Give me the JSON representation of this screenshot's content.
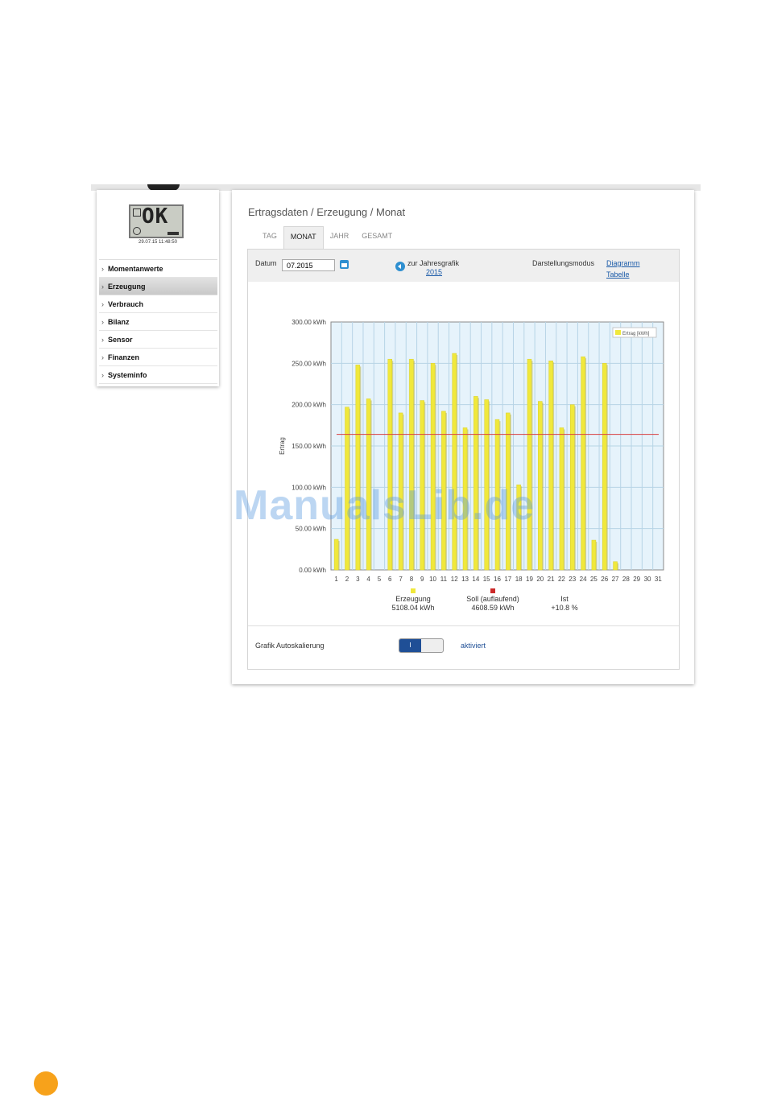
{
  "device": {
    "lcd_text": "OK",
    "timestamp": "29.07.15 11:48:50"
  },
  "menu": [
    {
      "label": "Momentanwerte",
      "active": false
    },
    {
      "label": "Erzeugung",
      "active": true
    },
    {
      "label": "Verbrauch",
      "active": false
    },
    {
      "label": "Bilanz",
      "active": false
    },
    {
      "label": "Sensor",
      "active": false
    },
    {
      "label": "Finanzen",
      "active": false
    },
    {
      "label": "Systeminfo",
      "active": false
    }
  ],
  "breadcrumb": "Ertragsdaten / Erzeugung / Monat",
  "tabs": [
    {
      "label": "TAG",
      "active": false
    },
    {
      "label": "MONAT",
      "active": true
    },
    {
      "label": "JAHR",
      "active": false
    },
    {
      "label": "GESAMT",
      "active": false
    }
  ],
  "controls": {
    "datum_label": "Datum",
    "datum_value": "07.2015",
    "jahresgrafik_label": "zur Jahresgrafik",
    "jahresgrafik_link": "2015",
    "mode_label": "Darstellungsmodus",
    "mode_diagramm": "Diagramm",
    "mode_tabelle": "Tabelle"
  },
  "chart_data": {
    "type": "bar",
    "ylabel": "Ertrag",
    "ylim": [
      0,
      300
    ],
    "yticks": [
      "0.00 kWh",
      "50.00 kWh",
      "100.00 kWh",
      "150.00 kWh",
      "200.00 kWh",
      "250.00 kWh",
      "300.00 kWh"
    ],
    "categories": [
      "1",
      "2",
      "3",
      "4",
      "5",
      "6",
      "7",
      "8",
      "9",
      "10",
      "11",
      "12",
      "13",
      "14",
      "15",
      "16",
      "17",
      "18",
      "19",
      "20",
      "21",
      "22",
      "23",
      "24",
      "25",
      "26",
      "27",
      "28",
      "29",
      "30",
      "31"
    ],
    "series": [
      {
        "name": "Ertrag [kWh]",
        "color": "#f0e83c",
        "values": [
          37,
          197,
          248,
          207,
          0,
          255,
          190,
          255,
          205,
          250,
          192,
          262,
          172,
          210,
          206,
          182,
          190,
          103,
          255,
          204,
          253,
          172,
          200,
          258,
          36,
          250,
          10,
          0,
          0,
          0,
          0
        ]
      }
    ],
    "reference_line": {
      "value": 164,
      "color": "#d84040"
    },
    "legend": "top-right",
    "grid": true
  },
  "summary": [
    {
      "label": "Erzeugung",
      "value": "5108.04 kWh",
      "color": "#f0e83c"
    },
    {
      "label": "Soll (auflaufend)",
      "value": "4608.59 kWh",
      "color": "#cc2a2a"
    },
    {
      "label": "Ist",
      "value": "+10.8 %",
      "color": ""
    }
  ],
  "autoscale": {
    "label": "Grafik Autoskalierung",
    "toggle_text": "I",
    "status": "aktiviert"
  },
  "watermark": "ManualsLib.de"
}
